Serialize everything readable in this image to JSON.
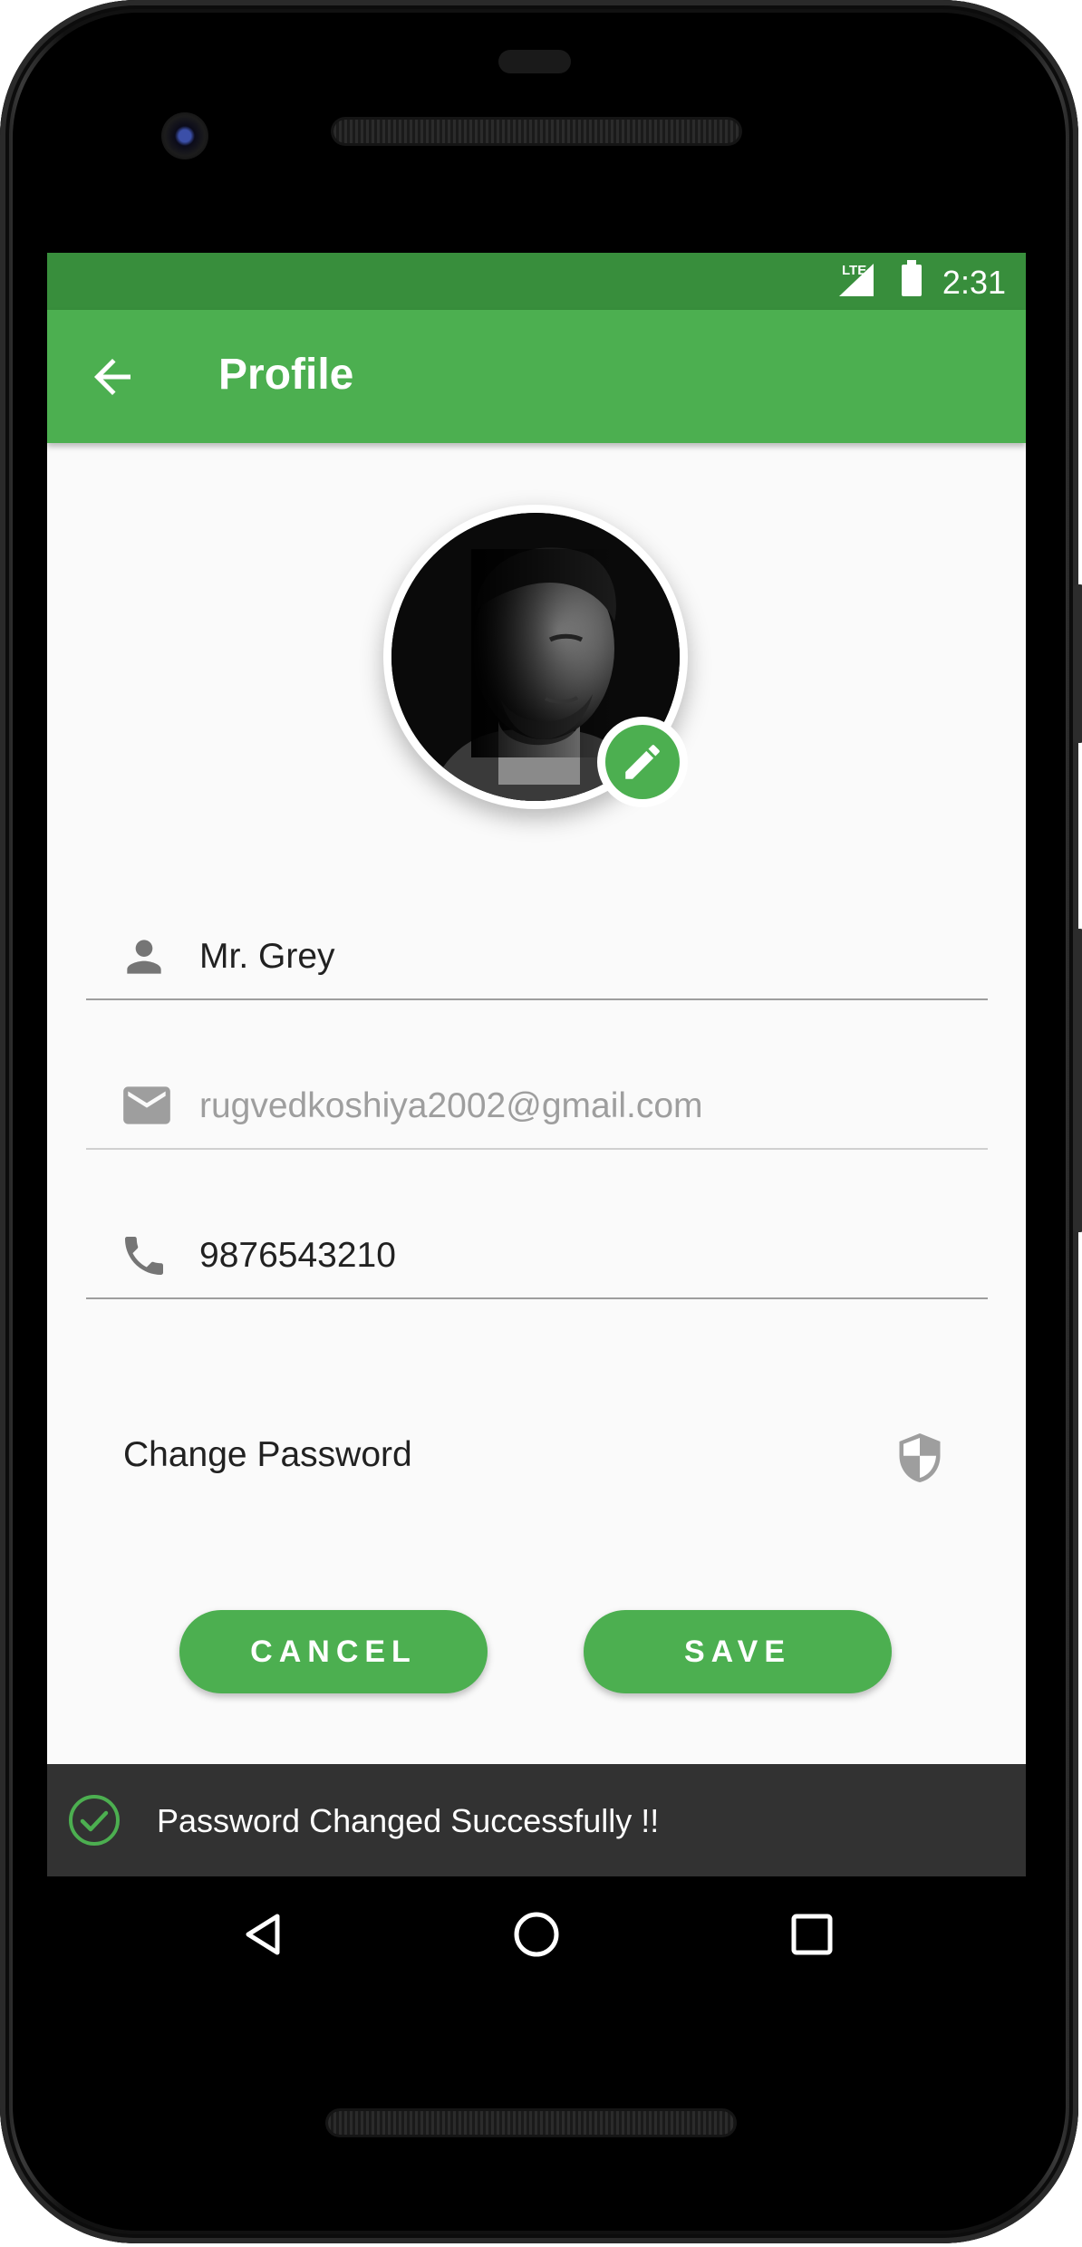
{
  "status_bar": {
    "network_label": "LTE",
    "time": "2:31",
    "icons": [
      "lte-signal-icon",
      "battery-icon"
    ]
  },
  "app_bar": {
    "title": "Profile",
    "back_icon": "arrow-back-icon"
  },
  "profile": {
    "avatar": "profile-photo",
    "edit_icon": "pencil-icon"
  },
  "fields": {
    "name": {
      "icon": "person-icon",
      "value": "Mr. Grey"
    },
    "email": {
      "icon": "email-icon",
      "value": "rugvedkoshiya2002@gmail.com"
    },
    "phone": {
      "icon": "phone-icon",
      "value": "9876543210"
    }
  },
  "change_password": {
    "label": "Change Password",
    "icon": "shield-icon"
  },
  "buttons": {
    "cancel": "CANCEL",
    "save": "SAVE"
  },
  "snackbar": {
    "icon": "check-circle-icon",
    "message": "Password Changed Successfully !!"
  },
  "nav_bar": {
    "icons": [
      "back-triangle-icon",
      "home-circle-icon",
      "recents-square-icon"
    ]
  },
  "colors": {
    "primary": "#4caf50",
    "primary_dark": "#388e3c",
    "snackbar_bg": "#323232",
    "background": "#fafafa"
  }
}
